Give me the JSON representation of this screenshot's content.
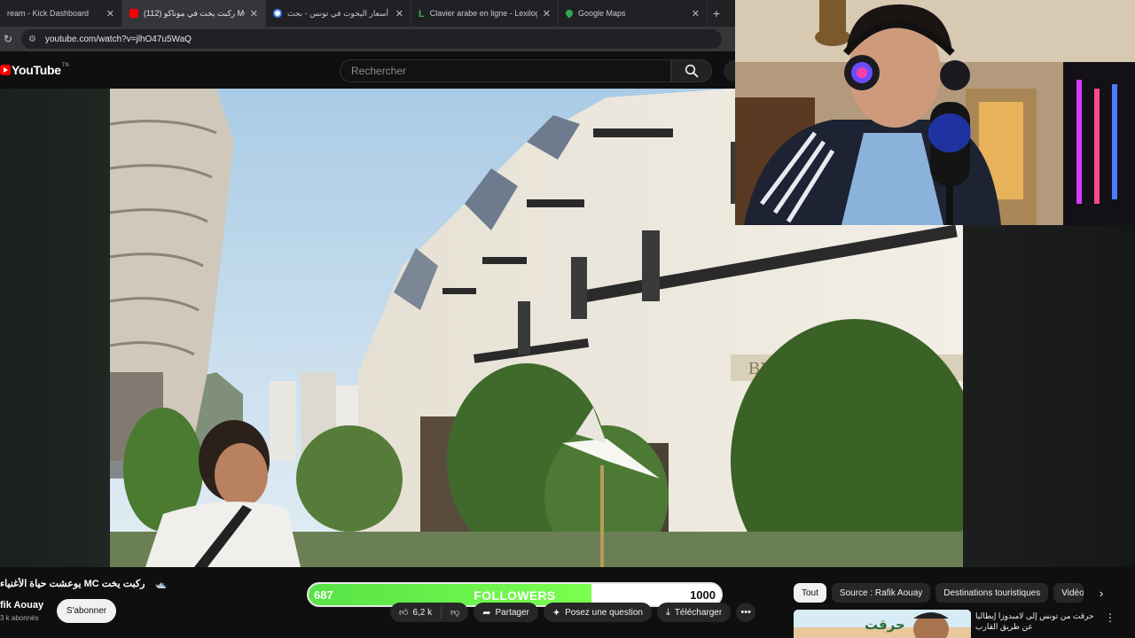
{
  "browser": {
    "tabs": [
      {
        "label": "ream - Kick Dashboard",
        "favicon": "kick-icon",
        "color": "#53fc18",
        "active": false
      },
      {
        "label": "(112) ركبت يخت في موناكو MC",
        "favicon": "youtube-icon",
        "color": "#ff0000",
        "active": true
      },
      {
        "label": "أسعار اليخوت في تونس - بحث",
        "favicon": "google-icon",
        "color": "#4285f4",
        "active": false
      },
      {
        "label": "Clavier arabe en ligne - Lexilogos",
        "favicon": "lexilogos-icon",
        "color": "#3db33d",
        "active": false
      },
      {
        "label": "Google Maps",
        "favicon": "maps-icon",
        "color": "#34a853",
        "active": false
      }
    ],
    "url": "youtube.com/watch?v=jlhO47u5WaQ"
  },
  "youtube": {
    "logo_text": "YouTube",
    "logo_region": "TN",
    "search_placeholder": "Rechercher"
  },
  "video": {
    "title": "يوعشت حياة الأغنياء MC ركبت يخت",
    "title_emoji": "🛥️",
    "channel": "Rafik Aouay",
    "channel_display": "fik Aouay",
    "subscribers": "3 k abonnés",
    "subscribe_label": "S'abonner",
    "likes": "6,2 k",
    "share_label": "Partager",
    "ask_label": "Posez une question",
    "download_label": "Télécharger"
  },
  "followers_goal": {
    "current": "687",
    "label": "FOLLOWERS",
    "goal": "1000",
    "progress": 0.687
  },
  "chips": [
    "Tout",
    "Source : Rafik Aouay",
    "Destinations touristiques",
    "Vidéos"
  ],
  "recommendation": {
    "title": "حرقت من تونس إلى لامبدوزا إيطاليا عن طريق القارب",
    "thumb_text": "حرقت"
  },
  "colors": {
    "youtube_red": "#ff0000",
    "followers_green": "#5ee84a",
    "background": "#0f0f0f"
  }
}
